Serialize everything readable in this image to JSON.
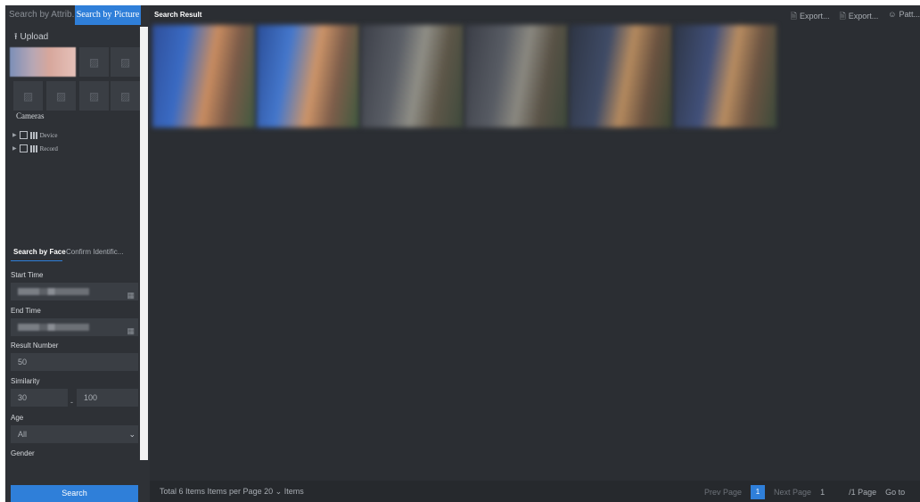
{
  "left_panel": {
    "tabs": {
      "attribute": "Search by Attrib...",
      "picture": "Search by Picture"
    },
    "upload_label": "Upload",
    "cameras_title": "Cameras",
    "tree": [
      {
        "label": "Device"
      },
      {
        "label": "Record"
      }
    ],
    "subtabs": {
      "face": "Search by Face",
      "confirm": "Confirm Identific..."
    },
    "start_time_label": "Start Time",
    "end_time_label": "End Time",
    "result_number_label": "Result Number",
    "result_number_value": "50",
    "similarity_label": "Similarity",
    "similarity_min": "30",
    "similarity_dash": "-",
    "similarity_max": "100",
    "age_label": "Age",
    "age_value": "All",
    "gender_label": "Gender",
    "search_button": "Search"
  },
  "main": {
    "title": "Search Result",
    "toolbar": [
      {
        "icon": "export-icon",
        "label": "Export..."
      },
      {
        "icon": "export-icon",
        "label": "Export..."
      },
      {
        "icon": "person-icon",
        "label": "Patt..."
      }
    ],
    "results_count": 6
  },
  "pager": {
    "total": "Total 6 Items",
    "per_page_label": "Items per Page",
    "per_page_value": "20",
    "items_label": "Items",
    "prev": "Prev Page",
    "current": "1",
    "next": "Next Page",
    "page_input": "1",
    "page_total": "/1 Page",
    "goto": "Go to"
  },
  "colors": {
    "accent": "#2f7fd9",
    "background": "#2b2e33",
    "panel": "#2e3136"
  }
}
